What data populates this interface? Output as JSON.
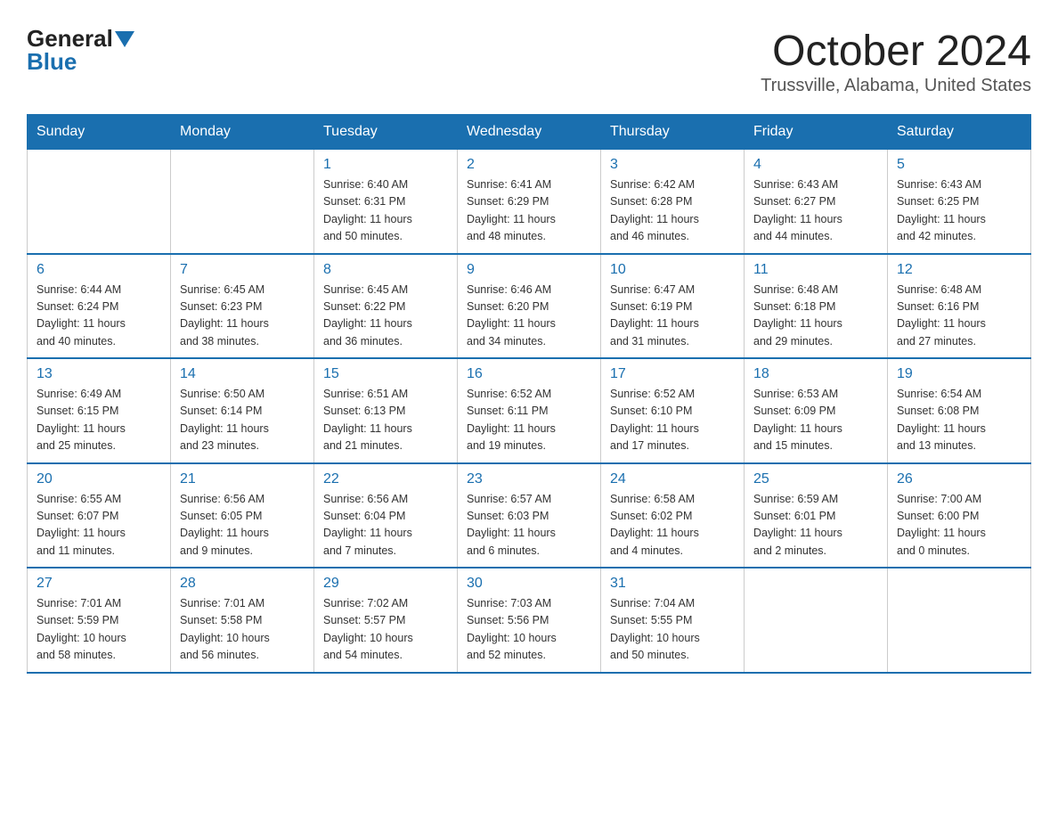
{
  "header": {
    "logo_general": "General",
    "logo_blue": "Blue",
    "title": "October 2024",
    "subtitle": "Trussville, Alabama, United States"
  },
  "weekdays": [
    "Sunday",
    "Monday",
    "Tuesday",
    "Wednesday",
    "Thursday",
    "Friday",
    "Saturday"
  ],
  "weeks": [
    [
      {
        "day": "",
        "info": ""
      },
      {
        "day": "",
        "info": ""
      },
      {
        "day": "1",
        "info": "Sunrise: 6:40 AM\nSunset: 6:31 PM\nDaylight: 11 hours\nand 50 minutes."
      },
      {
        "day": "2",
        "info": "Sunrise: 6:41 AM\nSunset: 6:29 PM\nDaylight: 11 hours\nand 48 minutes."
      },
      {
        "day": "3",
        "info": "Sunrise: 6:42 AM\nSunset: 6:28 PM\nDaylight: 11 hours\nand 46 minutes."
      },
      {
        "day": "4",
        "info": "Sunrise: 6:43 AM\nSunset: 6:27 PM\nDaylight: 11 hours\nand 44 minutes."
      },
      {
        "day": "5",
        "info": "Sunrise: 6:43 AM\nSunset: 6:25 PM\nDaylight: 11 hours\nand 42 minutes."
      }
    ],
    [
      {
        "day": "6",
        "info": "Sunrise: 6:44 AM\nSunset: 6:24 PM\nDaylight: 11 hours\nand 40 minutes."
      },
      {
        "day": "7",
        "info": "Sunrise: 6:45 AM\nSunset: 6:23 PM\nDaylight: 11 hours\nand 38 minutes."
      },
      {
        "day": "8",
        "info": "Sunrise: 6:45 AM\nSunset: 6:22 PM\nDaylight: 11 hours\nand 36 minutes."
      },
      {
        "day": "9",
        "info": "Sunrise: 6:46 AM\nSunset: 6:20 PM\nDaylight: 11 hours\nand 34 minutes."
      },
      {
        "day": "10",
        "info": "Sunrise: 6:47 AM\nSunset: 6:19 PM\nDaylight: 11 hours\nand 31 minutes."
      },
      {
        "day": "11",
        "info": "Sunrise: 6:48 AM\nSunset: 6:18 PM\nDaylight: 11 hours\nand 29 minutes."
      },
      {
        "day": "12",
        "info": "Sunrise: 6:48 AM\nSunset: 6:16 PM\nDaylight: 11 hours\nand 27 minutes."
      }
    ],
    [
      {
        "day": "13",
        "info": "Sunrise: 6:49 AM\nSunset: 6:15 PM\nDaylight: 11 hours\nand 25 minutes."
      },
      {
        "day": "14",
        "info": "Sunrise: 6:50 AM\nSunset: 6:14 PM\nDaylight: 11 hours\nand 23 minutes."
      },
      {
        "day": "15",
        "info": "Sunrise: 6:51 AM\nSunset: 6:13 PM\nDaylight: 11 hours\nand 21 minutes."
      },
      {
        "day": "16",
        "info": "Sunrise: 6:52 AM\nSunset: 6:11 PM\nDaylight: 11 hours\nand 19 minutes."
      },
      {
        "day": "17",
        "info": "Sunrise: 6:52 AM\nSunset: 6:10 PM\nDaylight: 11 hours\nand 17 minutes."
      },
      {
        "day": "18",
        "info": "Sunrise: 6:53 AM\nSunset: 6:09 PM\nDaylight: 11 hours\nand 15 minutes."
      },
      {
        "day": "19",
        "info": "Sunrise: 6:54 AM\nSunset: 6:08 PM\nDaylight: 11 hours\nand 13 minutes."
      }
    ],
    [
      {
        "day": "20",
        "info": "Sunrise: 6:55 AM\nSunset: 6:07 PM\nDaylight: 11 hours\nand 11 minutes."
      },
      {
        "day": "21",
        "info": "Sunrise: 6:56 AM\nSunset: 6:05 PM\nDaylight: 11 hours\nand 9 minutes."
      },
      {
        "day": "22",
        "info": "Sunrise: 6:56 AM\nSunset: 6:04 PM\nDaylight: 11 hours\nand 7 minutes."
      },
      {
        "day": "23",
        "info": "Sunrise: 6:57 AM\nSunset: 6:03 PM\nDaylight: 11 hours\nand 6 minutes."
      },
      {
        "day": "24",
        "info": "Sunrise: 6:58 AM\nSunset: 6:02 PM\nDaylight: 11 hours\nand 4 minutes."
      },
      {
        "day": "25",
        "info": "Sunrise: 6:59 AM\nSunset: 6:01 PM\nDaylight: 11 hours\nand 2 minutes."
      },
      {
        "day": "26",
        "info": "Sunrise: 7:00 AM\nSunset: 6:00 PM\nDaylight: 11 hours\nand 0 minutes."
      }
    ],
    [
      {
        "day": "27",
        "info": "Sunrise: 7:01 AM\nSunset: 5:59 PM\nDaylight: 10 hours\nand 58 minutes."
      },
      {
        "day": "28",
        "info": "Sunrise: 7:01 AM\nSunset: 5:58 PM\nDaylight: 10 hours\nand 56 minutes."
      },
      {
        "day": "29",
        "info": "Sunrise: 7:02 AM\nSunset: 5:57 PM\nDaylight: 10 hours\nand 54 minutes."
      },
      {
        "day": "30",
        "info": "Sunrise: 7:03 AM\nSunset: 5:56 PM\nDaylight: 10 hours\nand 52 minutes."
      },
      {
        "day": "31",
        "info": "Sunrise: 7:04 AM\nSunset: 5:55 PM\nDaylight: 10 hours\nand 50 minutes."
      },
      {
        "day": "",
        "info": ""
      },
      {
        "day": "",
        "info": ""
      }
    ]
  ]
}
